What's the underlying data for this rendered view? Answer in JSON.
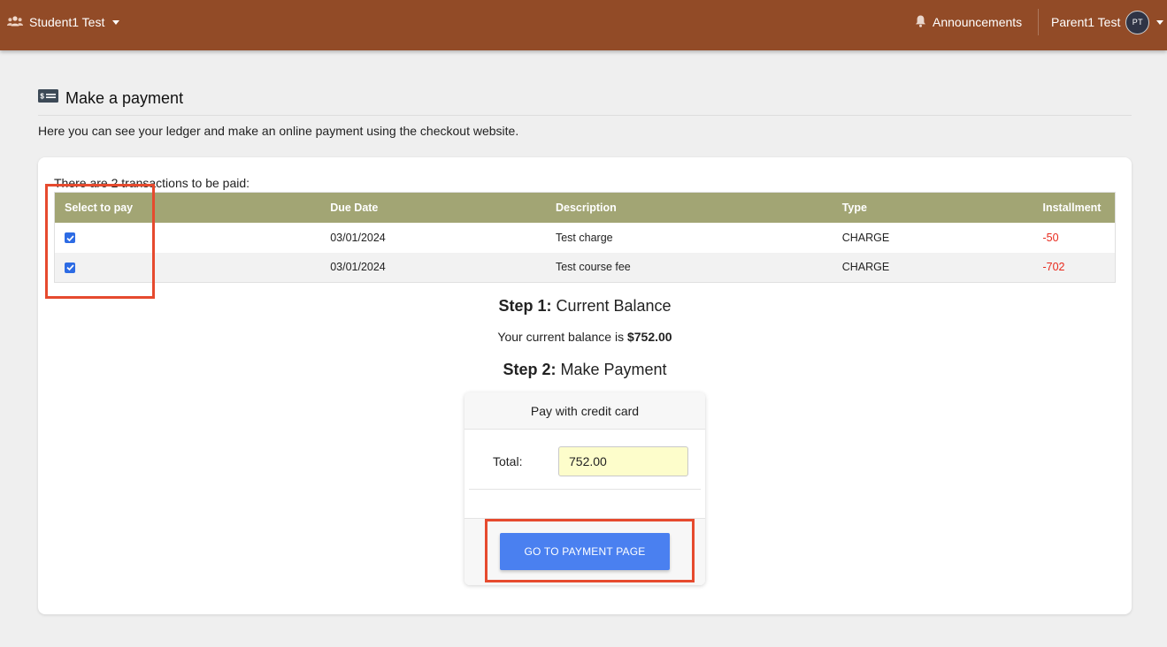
{
  "topbar": {
    "student_name": "Student1 Test",
    "announcements_label": "Announcements",
    "parent_name": "Parent1 Test",
    "avatar_initials": "PT",
    "bar_color": "#924b27"
  },
  "page": {
    "title": "Make a payment",
    "intro": "Here you can see your ledger and make an online payment using the checkout website."
  },
  "ledger": {
    "count_text": "There are 2 transactions to be paid:",
    "columns": [
      "Select to pay",
      "Due Date",
      "Description",
      "Type",
      "Installment"
    ],
    "rows": [
      {
        "selected": true,
        "due_date": "03/01/2024",
        "description": "Test charge",
        "type": "CHARGE",
        "installment": "-50"
      },
      {
        "selected": true,
        "due_date": "03/01/2024",
        "description": "Test course fee",
        "type": "CHARGE",
        "installment": "-702"
      }
    ],
    "header_color": "#a2a574"
  },
  "steps": {
    "step1_label": "Step 1:",
    "step1_title": "Current Balance",
    "balance_prefix": "Your current balance is",
    "balance_value": "$752.00",
    "step2_label": "Step 2:",
    "step2_title": "Make Payment"
  },
  "payment": {
    "card_title": "Pay with credit card",
    "total_label": "Total:",
    "total_value": "752.00",
    "button_label": "GO TO PAYMENT PAGE",
    "button_color": "#4a80f0"
  },
  "icons": {
    "students": "users-icon",
    "announcements": "bell-icon",
    "payment": "money-bill-icon"
  },
  "annotation_color": "#e64a2e"
}
